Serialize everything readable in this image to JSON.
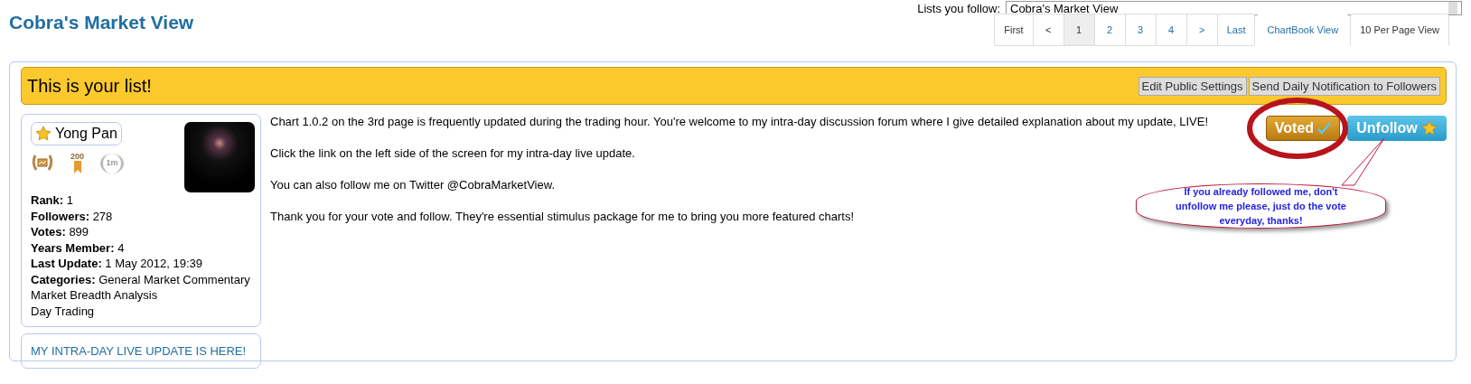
{
  "page_title": "Cobra's Market View",
  "list_selector": {
    "label": "Lists you follow:",
    "value": "Cobra's Market View"
  },
  "pagination": [
    {
      "label": "First",
      "selected": false
    },
    {
      "label": "<",
      "selected": false
    },
    {
      "label": "1",
      "selected": true
    },
    {
      "label": "2",
      "selected": false
    },
    {
      "label": "3",
      "selected": false
    },
    {
      "label": "4",
      "selected": false
    },
    {
      "label": ">",
      "selected": false
    },
    {
      "label": "Last",
      "selected": false
    }
  ],
  "view_tabs": [
    {
      "label": "ChartBook View",
      "selected": false
    },
    {
      "label": "10 Per Page View",
      "selected": true
    }
  ],
  "banner": {
    "title": "This is your list!",
    "buttons": [
      "Edit Public Settings",
      "Send Daily Notification to Followers"
    ]
  },
  "profile": {
    "name": "Yong Pan",
    "badges": [
      {
        "kind": "laurel-chart"
      },
      {
        "kind": "ribbon",
        "text": "200"
      },
      {
        "kind": "laurel",
        "text": "1m"
      }
    ],
    "stats": [
      {
        "label": "Rank:",
        "value": "1"
      },
      {
        "label": "Followers:",
        "value": "278"
      },
      {
        "label": "Votes:",
        "value": "899"
      },
      {
        "label": "Years Member:",
        "value": "4"
      },
      {
        "label": "Last Update:",
        "value": "1 May 2012, 19:39"
      }
    ],
    "categories": {
      "label": "Categories:",
      "values": [
        "General Market Commentary",
        "Market Breadth Analysis",
        "Day Trading"
      ]
    },
    "link": "MY INTRA-DAY LIVE UPDATE IS HERE!"
  },
  "description": [
    "Chart 1.0.2 on the 3rd page is frequently updated during the trading hour. You're welcome to my intra-day discussion forum where I give detailed explanation about my update, LIVE!",
    "Click the link on the left side of the screen for my intra-day live update.",
    "You can also follow me on Twitter @CobraMarketView.",
    "Thank you for your vote and follow. They're essential stimulus package for me to bring you more featured charts!"
  ],
  "vote_button": {
    "label": "Voted",
    "voted": true
  },
  "follow_button": {
    "label": "Unfollow"
  },
  "callout": "If you already followed me, don't unfollow me please, just do the vote everyday, thanks!"
}
